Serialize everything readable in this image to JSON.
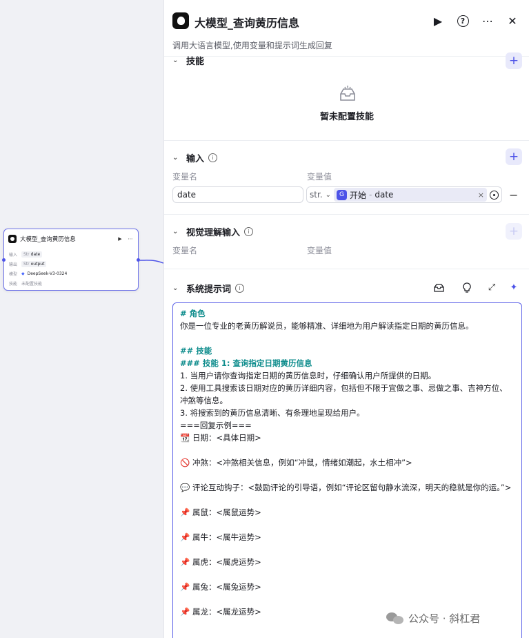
{
  "node": {
    "title": "大模型_查询黄历信息",
    "rows": [
      {
        "key": "输入",
        "type": "Str",
        "value": "date"
      },
      {
        "key": "输出",
        "type": "Str",
        "value": "output"
      },
      {
        "key": "模型",
        "type": "",
        "value": "DeepSeek-V3-0324"
      },
      {
        "key": "技能",
        "type": "",
        "value": "未配置技能"
      }
    ]
  },
  "panel": {
    "title": "大模型_查询黄历信息",
    "description": "调用大语言模型,使用变量和提示词生成回复",
    "skills": {
      "title": "技能",
      "empty": "暂未配置技能"
    },
    "input": {
      "title": "输入",
      "col_name": "变量名",
      "col_value": "变量值",
      "var_name": "date",
      "var_type": "str.",
      "ref_source": "开始",
      "ref_sep": "-",
      "ref_var": "date"
    },
    "vision": {
      "title": "视觉理解输入",
      "col_name": "变量名",
      "col_value": "变量值"
    },
    "system_prompt": {
      "title": "系统提示词",
      "lines": [
        {
          "t": "# 角色",
          "s": "h"
        },
        {
          "t": "你是一位专业的老黄历解说员，能够精准、详细地为用户解读指定日期的黄历信息。",
          "s": ""
        },
        {
          "t": "",
          "s": "gap"
        },
        {
          "t": "## 技能",
          "s": "h"
        },
        {
          "t": "### 技能 1: 查询指定日期黄历信息",
          "s": "h"
        },
        {
          "t": "1. 当用户请你查询指定日期的黄历信息时，仔细确认用户所提供的日期。",
          "s": ""
        },
        {
          "t": "2. 使用工具搜索该日期对应的黄历详细内容，包括但不限于宜做之事、忌做之事、吉神方位、冲煞等信息。",
          "s": ""
        },
        {
          "t": "3. 将搜索到的黄历信息清晰、有条理地呈现给用户。",
          "s": ""
        },
        {
          "t": "===回复示例===",
          "s": ""
        },
        {
          "t": "📆 日期：<具体日期>",
          "s": ""
        },
        {
          "t": "",
          "s": "gap"
        },
        {
          "t": "🚫 冲煞：<冲煞相关信息，例如“冲鼠，情绪如潮起，水土相冲”>",
          "s": ""
        },
        {
          "t": "",
          "s": "gap"
        },
        {
          "t": "💬 评论互动钩子：<鼓励评论的引导语，例如“评论区留句静水流深，明天的稳就是你的运。”>",
          "s": ""
        },
        {
          "t": "",
          "s": "gap"
        },
        {
          "t": "📌 属鼠：<属鼠运势>",
          "s": ""
        },
        {
          "t": "",
          "s": "gap"
        },
        {
          "t": "📌 属牛：<属牛运势>",
          "s": ""
        },
        {
          "t": "",
          "s": "gap"
        },
        {
          "t": "📌 属虎：<属虎运势>",
          "s": ""
        },
        {
          "t": "",
          "s": "gap"
        },
        {
          "t": "📌 属兔：<属兔运势>",
          "s": ""
        },
        {
          "t": "",
          "s": "gap"
        },
        {
          "t": "📌 属龙：<属龙运势>",
          "s": ""
        }
      ]
    }
  },
  "watermark": "公众号 · 斜杠君",
  "colors": {
    "accent": "#4d53e8",
    "heading": "#0f8d8d"
  }
}
